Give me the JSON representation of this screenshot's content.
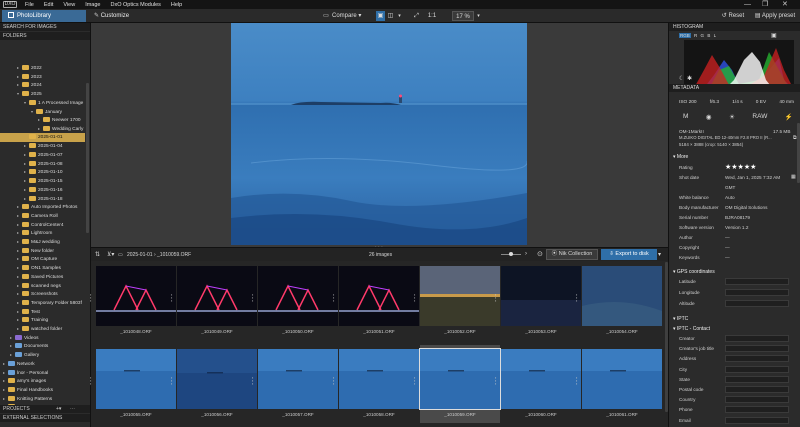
{
  "menu": {
    "logo": "DXO",
    "items": [
      "File",
      "Edit",
      "View",
      "Image",
      "DxO Optics Modules",
      "Help"
    ],
    "win_controls": [
      "—",
      "❐",
      "✕"
    ]
  },
  "toolbar": {
    "photolibrary": "PhotoLibrary",
    "customize": "Customize",
    "compare": "Compare",
    "ratio": "1:1",
    "zoom": "17 %",
    "reset": "Reset",
    "apply_preset": "Apply preset"
  },
  "left": {
    "search_header": "SEARCH FOR IMAGES",
    "folders_header": "FOLDERS",
    "tree": [
      {
        "label": "2022",
        "indent": 2,
        "expanded": false,
        "color": "yellow"
      },
      {
        "label": "2023",
        "indent": 2,
        "expanded": false,
        "color": "yellow"
      },
      {
        "label": "2024",
        "indent": 2,
        "expanded": false,
        "color": "yellow"
      },
      {
        "label": "2025",
        "indent": 2,
        "expanded": true,
        "color": "yellow"
      },
      {
        "label": "1 A Processed Image",
        "indent": 3,
        "expanded": true,
        "color": "yellow"
      },
      {
        "label": "January",
        "indent": 4,
        "expanded": true,
        "color": "yellow"
      },
      {
        "label": "Neewer 1700",
        "indent": 5,
        "expanded": false,
        "color": "yellow"
      },
      {
        "label": "Wedding Carly",
        "indent": 5,
        "expanded": false,
        "color": "yellow"
      },
      {
        "label": "2025-01-01",
        "indent": 3,
        "expanded": null,
        "color": "yellow",
        "selected": true
      },
      {
        "label": "2025-01-04",
        "indent": 3,
        "expanded": false,
        "color": "yellow"
      },
      {
        "label": "2025-01-07",
        "indent": 3,
        "expanded": false,
        "color": "yellow"
      },
      {
        "label": "2025-01-08",
        "indent": 3,
        "expanded": false,
        "color": "yellow"
      },
      {
        "label": "2025-01-10",
        "indent": 3,
        "expanded": false,
        "color": "yellow"
      },
      {
        "label": "2025-01-15",
        "indent": 3,
        "expanded": false,
        "color": "yellow"
      },
      {
        "label": "2025-01-16",
        "indent": 3,
        "expanded": false,
        "color": "yellow"
      },
      {
        "label": "2025-01-18",
        "indent": 3,
        "expanded": false,
        "color": "yellow"
      },
      {
        "label": "Auto Imported Photos",
        "indent": 2,
        "expanded": false,
        "color": "yellow"
      },
      {
        "label": "Camera Roll",
        "indent": 2,
        "expanded": false,
        "color": "yellow"
      },
      {
        "label": "ControlCenter4",
        "indent": 2,
        "expanded": false,
        "color": "yellow"
      },
      {
        "label": "Lightroom",
        "indent": 2,
        "expanded": false,
        "color": "yellow"
      },
      {
        "label": "M&J wedding",
        "indent": 2,
        "expanded": false,
        "color": "yellow"
      },
      {
        "label": "New folder",
        "indent": 2,
        "expanded": false,
        "color": "yellow"
      },
      {
        "label": "OM Capture",
        "indent": 2,
        "expanded": false,
        "color": "yellow"
      },
      {
        "label": "ON1 Samples",
        "indent": 2,
        "expanded": false,
        "color": "yellow"
      },
      {
        "label": "Saved Pictures",
        "indent": 2,
        "expanded": false,
        "color": "yellow"
      },
      {
        "label": "scanned negs",
        "indent": 2,
        "expanded": false,
        "color": "yellow"
      },
      {
        "label": "Screenshots",
        "indent": 2,
        "expanded": false,
        "color": "yellow"
      },
      {
        "label": "Temporary Folder 5803f",
        "indent": 2,
        "expanded": false,
        "color": "yellow"
      },
      {
        "label": "Test",
        "indent": 2,
        "expanded": false,
        "color": "yellow"
      },
      {
        "label": "Training",
        "indent": 2,
        "expanded": false,
        "color": "yellow"
      },
      {
        "label": "watched folder",
        "indent": 2,
        "expanded": false,
        "color": "yellow"
      },
      {
        "label": "Videos",
        "indent": 1,
        "expanded": false,
        "color": "purple"
      },
      {
        "label": "Documents",
        "indent": 1,
        "expanded": false,
        "color": "blue"
      },
      {
        "label": "Gallery",
        "indent": 1,
        "expanded": false,
        "color": "blue"
      },
      {
        "label": "Network",
        "indent": 0,
        "expanded": false,
        "color": "blue"
      },
      {
        "label": "lnor - Personal",
        "indent": 0,
        "expanded": false,
        "color": "blue"
      },
      {
        "label": "amy's images",
        "indent": 0,
        "expanded": false,
        "color": "yellow"
      },
      {
        "label": "Final Handbooks",
        "indent": 0,
        "expanded": false,
        "color": "yellow"
      },
      {
        "label": "Knitting Patterns",
        "indent": 0,
        "expanded": false,
        "color": "yellow"
      },
      {
        "label": "LRPS",
        "indent": 0,
        "expanded": false,
        "color": "yellow"
      }
    ],
    "projects_header": "PROJECTS",
    "external_header": "EXTERNAL SELECTIONS"
  },
  "thumbbar": {
    "breadcrumb": "2025-01-01 › _1010059.ORF",
    "count": "26 images",
    "nik": "Nik Collection",
    "export": "Export to disk"
  },
  "thumbs": [
    {
      "name": "_1010048.ORF",
      "style": "night-red"
    },
    {
      "name": "_1010049.ORF",
      "style": "night-red"
    },
    {
      "name": "_1010050.ORF",
      "style": "night-red"
    },
    {
      "name": "_1010051.ORF",
      "style": "night-red"
    },
    {
      "name": "_1010052.ORF",
      "style": "dusk"
    },
    {
      "name": "_1010053.ORF",
      "style": "dark-blue"
    },
    {
      "name": "_1010054.ORF",
      "style": "blue-shore"
    },
    {
      "name": "_1010055.ORF",
      "style": "blue"
    },
    {
      "name": "_1010056.ORF",
      "style": "blue-dark"
    },
    {
      "name": "_1010057.ORF",
      "style": "blue"
    },
    {
      "name": "_1010058.ORF",
      "style": "blue"
    },
    {
      "name": "_1010059.ORF",
      "style": "blue",
      "selected": true
    },
    {
      "name": "_1010060.ORF",
      "style": "blue"
    },
    {
      "name": "_1010061.ORF",
      "style": "blue"
    }
  ],
  "right": {
    "histogram_header": "HISTOGRAM",
    "channels": [
      "RGB",
      "R",
      "G",
      "B",
      "L"
    ],
    "metadata_header": "METADATA",
    "exif": [
      "ISO 200",
      "f/6.3",
      "1/4 s",
      "0 EV",
      "40 mm"
    ],
    "modes": [
      "M",
      "",
      "",
      "RAW"
    ],
    "camera": "OM-1MarkII",
    "size": "17.5 MB",
    "lens": "M.ZUIKO DIGITAL ED 12-40mm F2.8 PRO II (R...",
    "dims": "5184 × 3888 (crop: 5140 × 3854)",
    "more_header": "More",
    "fields": [
      {
        "label": "Rating",
        "value": "★★★★★"
      },
      {
        "label": "Shot date",
        "value": "Wed, Jan 1, 2025 7:32 AM"
      },
      {
        "label": "",
        "value": "GMT"
      },
      {
        "label": "White balance",
        "value": "Auto"
      },
      {
        "label": "Body manufacturer",
        "value": "OM Digital Solutions"
      },
      {
        "label": "Serial number",
        "value": "BJRA08179"
      },
      {
        "label": "Software version",
        "value": "Version 1.2"
      },
      {
        "label": "Author",
        "value": "—"
      },
      {
        "label": "Copyright",
        "value": "—"
      },
      {
        "label": "Keywords",
        "value": "—"
      }
    ],
    "gps_header": "GPS coordinates",
    "gps": [
      "Latitude",
      "Longitude",
      "Altitude"
    ],
    "iptc_header": "IPTC",
    "iptc_contact_header": "IPTC - Contact",
    "iptc": [
      "Creator",
      "Creator's job title",
      "Address",
      "City",
      "State",
      "Postal code",
      "Country",
      "Phone",
      "Email"
    ]
  }
}
